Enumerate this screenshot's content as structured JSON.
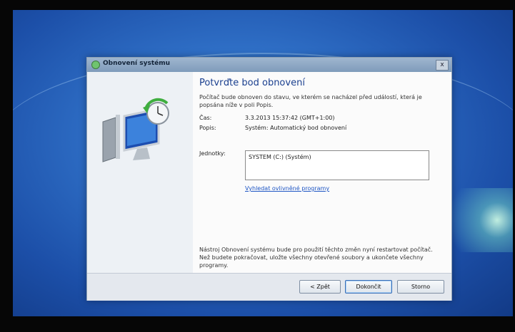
{
  "window": {
    "title": "Obnovení systému",
    "close_label": "x"
  },
  "main": {
    "heading": "Potvrďte bod obnovení",
    "description": "Počítač bude obnoven do stavu, ve kterém se nacházel před událostí, která je popsána níže v poli Popis.",
    "time_label": "Čas:",
    "time_value": "3.3.2013 15:37:42 (GMT+1:00)",
    "description_label": "Popis:",
    "description_value": "Systém: Automatický bod obnovení",
    "drives_label": "Jednotky:",
    "drives_value": "SYSTEM (C:) (Systém)",
    "affected_programs_link": "Vyhledat ovlivněné programy",
    "restart_note": "Nástroj Obnovení systému bude pro použití těchto změn nyní restartovat počítač. Než budete pokračovat, uložte všechny otevřené soubory a ukončete všechny programy."
  },
  "footer": {
    "back_label": "< Zpět",
    "finish_label": "Dokončit",
    "cancel_label": "Storno"
  }
}
